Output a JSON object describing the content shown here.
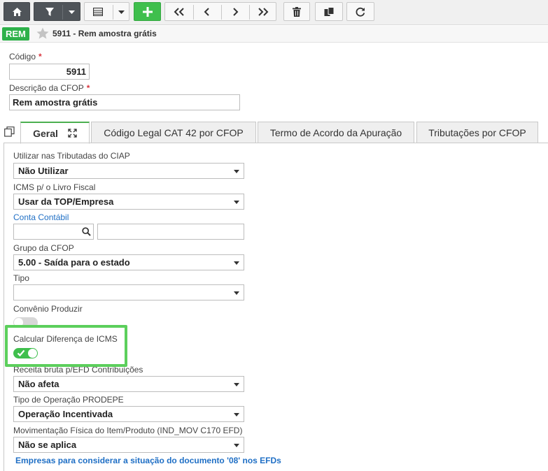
{
  "toolbar": {
    "buttons": [
      {
        "name": "home-button",
        "icon": "home-icon"
      },
      {
        "name": "filter-button",
        "icon": "filter-icon"
      },
      {
        "name": "grid-view-button",
        "icon": "grid-icon"
      },
      {
        "name": "add-button",
        "icon": "plus-icon"
      },
      {
        "name": "first-record-button",
        "icon": "double-chevron-left-icon"
      },
      {
        "name": "previous-record-button",
        "icon": "chevron-left-icon"
      },
      {
        "name": "next-record-button",
        "icon": "chevron-right-icon"
      },
      {
        "name": "last-record-button",
        "icon": "double-chevron-right-icon"
      },
      {
        "name": "delete-button",
        "icon": "trash-icon"
      },
      {
        "name": "duplicate-button",
        "icon": "copy-icon"
      },
      {
        "name": "refresh-button",
        "icon": "refresh-icon"
      }
    ],
    "colors": {
      "dark": "#4f5459",
      "green": "#3fbf4d"
    }
  },
  "header": {
    "badge": "REM",
    "title": "5911 - Rem amostra grátis",
    "badge_color": "#2eb14a"
  },
  "form": {
    "codigo_label": "Código",
    "codigo_value": "5911",
    "descricao_label": "Descrição da CFOP",
    "descricao_value": "Rem amostra grátis",
    "required_mark": "*"
  },
  "tabs": [
    {
      "label": "Geral",
      "active": true
    },
    {
      "label": "Código Legal CAT 42 por CFOP",
      "active": false
    },
    {
      "label": "Termo de Acordo da Apuração",
      "active": false
    },
    {
      "label": "Tributações por CFOP",
      "active": false
    }
  ],
  "geral": {
    "ciap_label": "Utilizar nas Tributadas do CIAP",
    "ciap_value": "Não Utilizar",
    "icms_livro_label": "ICMS p/ o Livro Fiscal",
    "icms_livro_value": "Usar da TOP/Empresa",
    "conta_contabil_label": "Conta Contábil",
    "conta_contabil_code": "",
    "conta_contabil_desc": "",
    "grupo_label": "Grupo da CFOP",
    "grupo_value": "5.00 - Saída para o estado",
    "tipo_label": "Tipo",
    "tipo_value": "",
    "convenio_label": "Convênio Produzir",
    "convenio_on": false,
    "calc_dif_label": "Calcular Diferença de ICMS",
    "calc_dif_on": true,
    "receita_label": "Receita bruta p/EFD Contribuições",
    "receita_value": "Não afeta",
    "prodepe_label": "Tipo de Operação PRODEPE",
    "prodepe_value": "Operação Incentivada",
    "mov_label": "Movimentação Física do Item/Produto (IND_MOV C170 EFD)",
    "mov_value": "Não se aplica",
    "empresas_link": "Empresas para considerar a situação do documento '08' nos EFDs",
    "highlight_color": "#5ccf5c"
  }
}
